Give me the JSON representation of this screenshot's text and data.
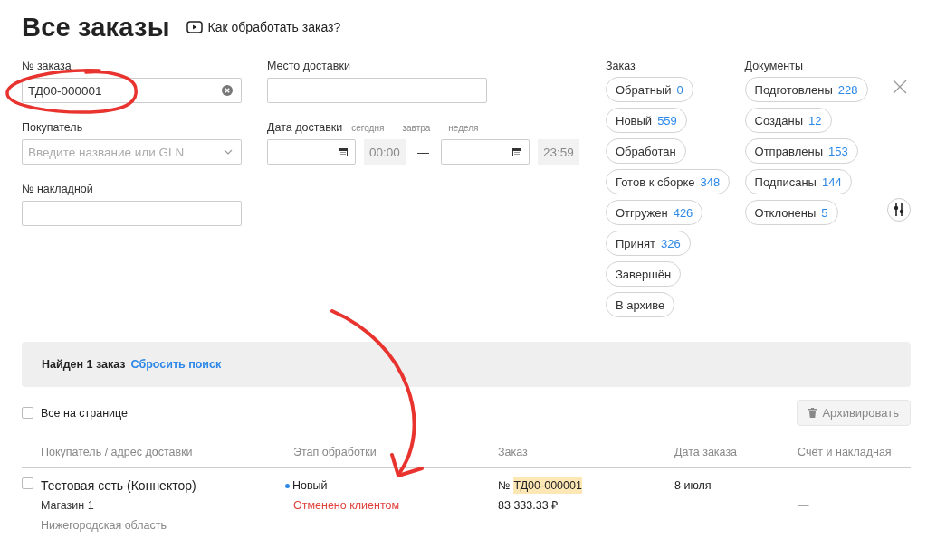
{
  "header": {
    "title": "Все заказы",
    "help_link": "Как обработать заказ?"
  },
  "filters": {
    "order_number": {
      "label": "№ заказа",
      "value": "ТД00-000001"
    },
    "buyer": {
      "label": "Покупатель",
      "placeholder": "Введите название или GLN"
    },
    "invoice": {
      "label": "№ накладной"
    },
    "delivery_place": {
      "label": "Место доставки"
    },
    "delivery_date": {
      "label": "Дата доставки",
      "presets": [
        "сегодня",
        "завтра",
        "неделя"
      ],
      "time_from": "00:00",
      "separator": "—",
      "time_to": "23:59"
    }
  },
  "order_status": {
    "title": "Заказ",
    "chips": [
      {
        "label": "Обратный",
        "count": "0"
      },
      {
        "label": "Новый",
        "count": "559"
      },
      {
        "label": "Обработан"
      },
      {
        "label": "Готов к сборке",
        "count": "348"
      },
      {
        "label": "Отгружен",
        "count": "426"
      },
      {
        "label": "Принят",
        "count": "326"
      },
      {
        "label": "Завершён"
      },
      {
        "label": "В архиве"
      }
    ]
  },
  "documents": {
    "title": "Документы",
    "chips": [
      {
        "label": "Подготовлены",
        "count": "228"
      },
      {
        "label": "Созданы",
        "count": "12"
      },
      {
        "label": "Отправлены",
        "count": "153"
      },
      {
        "label": "Подписаны",
        "count": "144"
      },
      {
        "label": "Отклонены",
        "count": "5"
      }
    ]
  },
  "result_bar": {
    "found": "Найден 1 заказ",
    "reset_link": "Сбросить поиск"
  },
  "select_all": {
    "label": "Все на странице",
    "checked": false
  },
  "archive_button": {
    "label": "Архивировать",
    "disabled": true
  },
  "table": {
    "columns": [
      "Покупатель / адрес доставки",
      "Этап обработки",
      "Заказ",
      "Дата заказа",
      "Счёт и накладная"
    ],
    "rows": [
      {
        "checked": false,
        "buyer": "Тестовая сеть (Коннектор)",
        "store": "Магазин 1",
        "region": "Нижегородская область",
        "stage": {
          "label": "Новый",
          "color": "#2b87e8"
        },
        "note": {
          "text": "Отменено клиентом",
          "kind": "error"
        },
        "order_prefix": "№",
        "order_number": "ТД00-000001",
        "order_highlighted": true,
        "amount": "83 333.33 ₽",
        "date": "8 июля",
        "docs": [
          "—",
          "—"
        ]
      }
    ]
  }
}
